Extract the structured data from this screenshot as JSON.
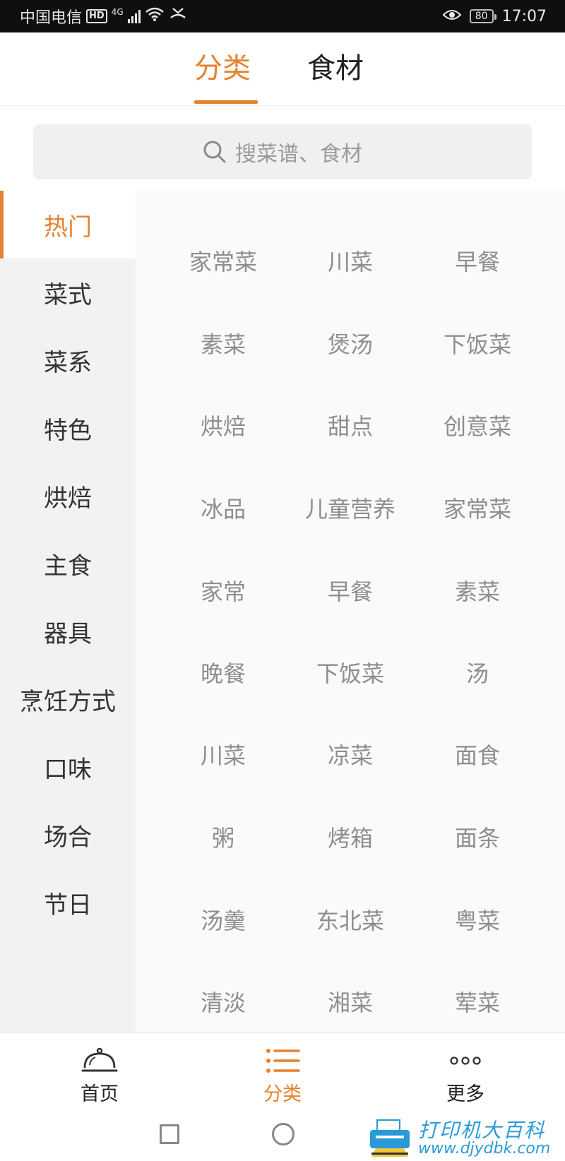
{
  "status_bar": {
    "carrier": "中国电信",
    "hd_badge": "HD",
    "network": "4G",
    "battery": "80",
    "time": "17:07",
    "icons": [
      "signal-icon",
      "wifi-icon",
      "missed-call-icon",
      "eye-icon",
      "battery-icon"
    ]
  },
  "top_tabs": [
    {
      "label": "分类",
      "active": true
    },
    {
      "label": "食材",
      "active": false
    }
  ],
  "search": {
    "placeholder": "搜菜谱、食材",
    "icon": "search-icon"
  },
  "side_nav": [
    {
      "label": "热门",
      "active": true
    },
    {
      "label": "菜式"
    },
    {
      "label": "菜系"
    },
    {
      "label": "特色"
    },
    {
      "label": "烘焙"
    },
    {
      "label": "主食"
    },
    {
      "label": "器具"
    },
    {
      "label": "烹饪方式"
    },
    {
      "label": "口味"
    },
    {
      "label": "场合"
    },
    {
      "label": "节日"
    }
  ],
  "grid_rows": [
    [
      "家常菜",
      "川菜",
      "早餐"
    ],
    [
      "素菜",
      "煲汤",
      "下饭菜"
    ],
    [
      "烘焙",
      "甜点",
      "创意菜"
    ],
    [
      "冰品",
      "儿童营养",
      "家常菜"
    ],
    [
      "家常",
      "早餐",
      "素菜"
    ],
    [
      "晚餐",
      "下饭菜",
      "汤"
    ],
    [
      "川菜",
      "凉菜",
      "面食"
    ],
    [
      "粥",
      "烤箱",
      "面条"
    ],
    [
      "汤羹",
      "东北菜",
      "粤菜"
    ],
    [
      "清淡",
      "湘菜",
      "荤菜"
    ]
  ],
  "bottom_nav": [
    {
      "label": "首页",
      "icon": "cloche-icon",
      "active": false
    },
    {
      "label": "分类",
      "icon": "list-icon",
      "active": true
    },
    {
      "label": "更多",
      "icon": "more-dots-icon",
      "active": false
    }
  ],
  "system_nav": {
    "icons": [
      "recents-square-icon",
      "home-circle-icon"
    ]
  },
  "watermark": {
    "title": "打印机大百科",
    "url": "www.djydbk.com"
  },
  "colors": {
    "accent": "#e5822f",
    "sidebar_bg": "#f2f2f2",
    "grid_text": "#8e8e8e"
  }
}
